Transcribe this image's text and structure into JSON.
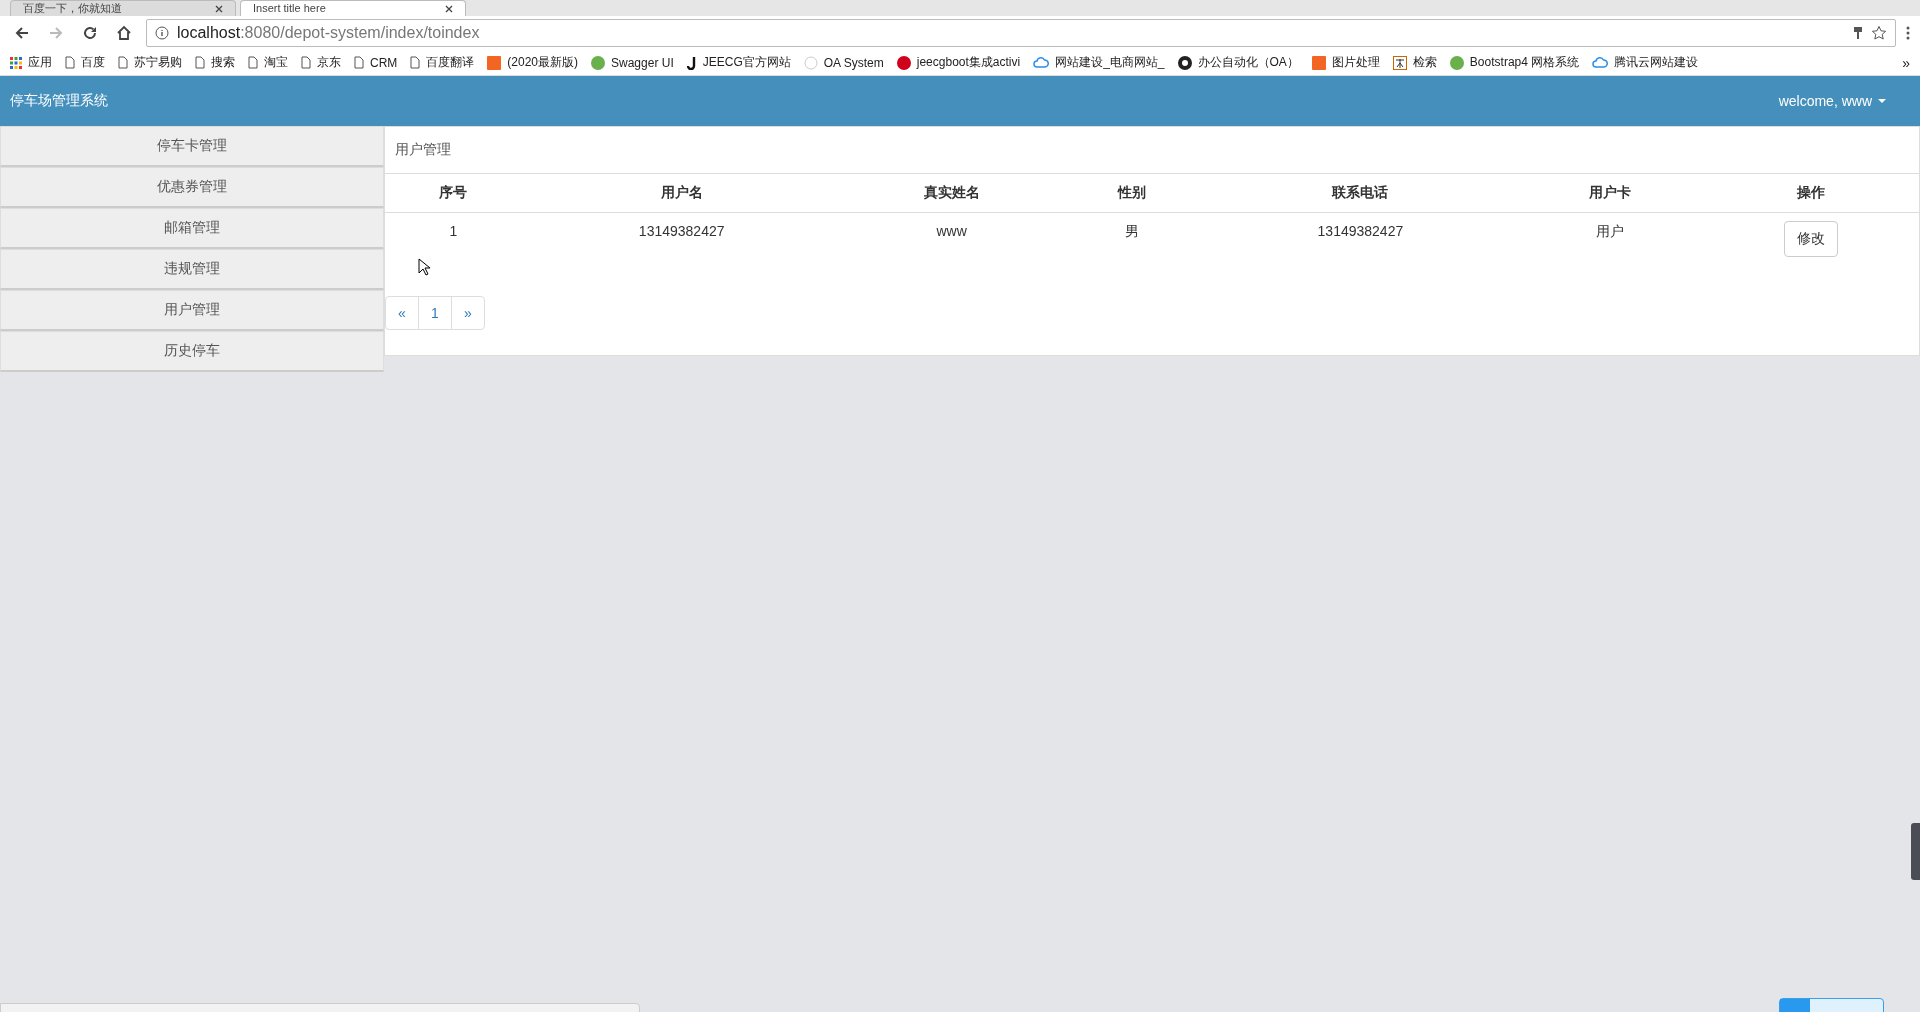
{
  "browser": {
    "tabs": [
      {
        "title": "百度一下，你就知道",
        "selected": false
      },
      {
        "title": "Insert title here",
        "selected": true
      }
    ],
    "address": {
      "host": "localhost",
      "rest": ":8080/depot-system/index/toindex"
    },
    "bookmarks": [
      {
        "label": "应用",
        "kind": "apps"
      },
      {
        "label": "百度",
        "kind": "page"
      },
      {
        "label": "苏宁易购",
        "kind": "page"
      },
      {
        "label": "搜索",
        "kind": "page"
      },
      {
        "label": "淘宝",
        "kind": "page"
      },
      {
        "label": "京东",
        "kind": "page"
      },
      {
        "label": "CRM",
        "kind": "page"
      },
      {
        "label": "百度翻译",
        "kind": "page"
      },
      {
        "label": "(2020最新版)",
        "kind": "orange"
      },
      {
        "label": "Swagger UI",
        "kind": "green"
      },
      {
        "label": "JEECG官方网站",
        "kind": "j"
      },
      {
        "label": "OA System",
        "kind": "faint"
      },
      {
        "label": "jeecgboot集成activi",
        "kind": "red"
      },
      {
        "label": "网站建设_电商网站_",
        "kind": "cloud"
      },
      {
        "label": "办公自动化（OA）",
        "kind": "github"
      },
      {
        "label": "图片处理",
        "kind": "orange"
      },
      {
        "label": "检索",
        "kind": "zhi"
      },
      {
        "label": "Bootstrap4 网格系统",
        "kind": "green"
      },
      {
        "label": "腾讯云网站建设",
        "kind": "cloud"
      }
    ],
    "more": "»"
  },
  "navbar": {
    "brand": "停车场管理系统",
    "user": "welcome, www"
  },
  "sidebar": {
    "items": [
      {
        "label": "停车卡管理",
        "selected": false
      },
      {
        "label": "优惠券管理",
        "selected": false
      },
      {
        "label": "邮箱管理",
        "selected": false
      },
      {
        "label": "违规管理",
        "selected": false
      },
      {
        "label": "用户管理",
        "selected": false
      },
      {
        "label": "历史停车",
        "selected": false
      }
    ]
  },
  "panel": {
    "title": "用户管理",
    "table": {
      "columns": [
        "序号",
        "用户名",
        "真实姓名",
        "性别",
        "联系电话",
        "用户卡",
        "操作"
      ],
      "rows": [
        {
          "cells": [
            "1",
            "13149382427",
            "www",
            "男",
            "13149382427",
            "用户"
          ],
          "action": "修改"
        }
      ]
    },
    "pagination": [
      {
        "label": "«",
        "selected": false
      },
      {
        "label": "1",
        "selected": false
      },
      {
        "label": "»",
        "selected": false
      }
    ]
  }
}
